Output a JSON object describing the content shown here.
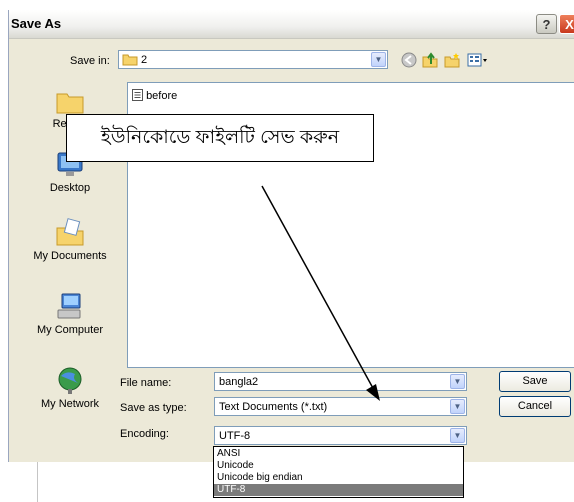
{
  "dialog": {
    "title": "Save As",
    "help_glyph": "?",
    "close_glyph": "X"
  },
  "save_in": {
    "label": "Save in:",
    "value": "2"
  },
  "toolbar": {
    "icons": [
      "back-icon",
      "up-folder-icon",
      "new-folder-icon",
      "view-menu-icon"
    ]
  },
  "places": [
    {
      "label": "Recent",
      "icon": "recent-documents-icon"
    },
    {
      "label": "Desktop",
      "icon": "desktop-icon"
    },
    {
      "label": "My Documents",
      "icon": "my-documents-icon"
    },
    {
      "label": "My Computer",
      "icon": "my-computer-icon"
    },
    {
      "label": "My Network",
      "icon": "my-network-icon"
    }
  ],
  "files": [
    {
      "name": "before",
      "icon": "text-file-icon"
    }
  ],
  "annotation": "ইউনিকোডে ফাইলটি সেভ করুন",
  "file_name": {
    "label": "File name:",
    "value": "bangla2"
  },
  "save_as_type": {
    "label": "Save as type:",
    "value": "Text Documents (*.txt)"
  },
  "encoding": {
    "label": "Encoding:",
    "value": "UTF-8",
    "options": [
      "ANSI",
      "Unicode",
      "Unicode big endian",
      "UTF-8"
    ],
    "selected_index": 3
  },
  "buttons": {
    "save": "Save",
    "cancel": "Cancel"
  },
  "colors": {
    "selection": "#7b7b7b",
    "close_button": "#d9502b",
    "field_border": "#7f9db9"
  }
}
